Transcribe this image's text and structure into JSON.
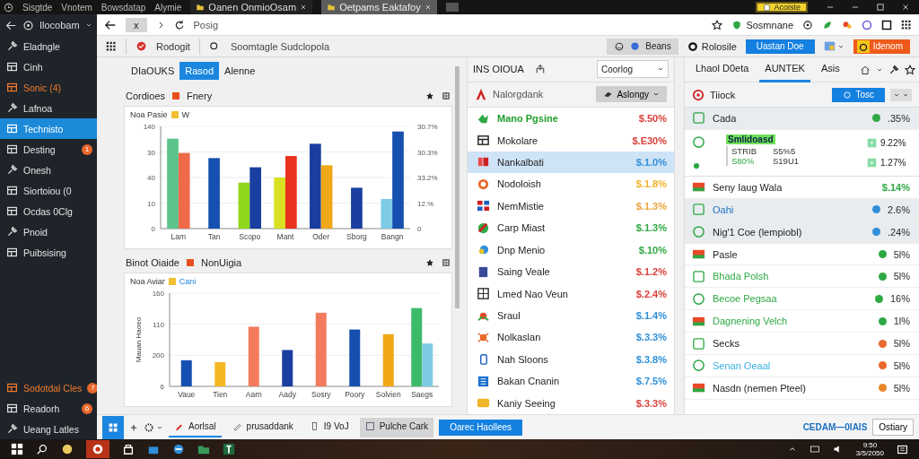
{
  "top_bar": {
    "menu": [
      "Sisgtde",
      "Vnotem",
      "Bowsdatap",
      "Alymie"
    ],
    "tabs": [
      {
        "label": "Oanen OnmioOsam",
        "selected": false
      },
      {
        "label": "Oetpams Eaktafoy",
        "selected": true
      }
    ],
    "badge": "Acoiste"
  },
  "sidebar": {
    "header": "Ilocobam",
    "items": [
      {
        "label": "Eladngle",
        "selected": false,
        "accent": false
      },
      {
        "label": "Cinh",
        "selected": false,
        "accent": false
      },
      {
        "label": "Sonic (4)",
        "selected": false,
        "accent": true
      },
      {
        "label": "Lafnoa",
        "selected": false,
        "accent": false
      },
      {
        "label": "Technisto",
        "selected": true,
        "accent": false
      },
      {
        "label": "Desting",
        "selected": false,
        "accent": false,
        "badge": "1"
      },
      {
        "label": "Onesh",
        "selected": false,
        "accent": false
      },
      {
        "label": "Siortoiou (0",
        "selected": false,
        "accent": false
      },
      {
        "label": "Ocdas 0Clg",
        "selected": false,
        "accent": false
      },
      {
        "label": "Pnoid",
        "selected": false,
        "accent": false
      },
      {
        "label": "Puibsising",
        "selected": false,
        "accent": false
      }
    ],
    "footer_items": [
      {
        "label": "Sodotdal Cles",
        "accent": true,
        "badge": "7"
      },
      {
        "label": "Readorh",
        "accent": false,
        "badge": "6"
      },
      {
        "label": "Ueang Latles",
        "accent": false
      }
    ]
  },
  "address_bar": {
    "stop": "x",
    "url": "Posig",
    "profile": "Sosmnane"
  },
  "toolbar": {
    "app_name": "Rodogit",
    "search_placeholder": "Soomtagle Sudclopola",
    "segment": "Beans",
    "account": "Rolosile",
    "primary_button": "Uastan Doe",
    "action_button": "Idenom"
  },
  "left_pane": {
    "tabs": [
      {
        "label": "DIaOUKS",
        "selected": false
      },
      {
        "label": "Rasod",
        "selected": true
      },
      {
        "label": "Alenne",
        "selected": false
      }
    ],
    "panels": [
      {
        "title": "Cordioes",
        "legend": "Fnery",
        "note": "Noa Pasie",
        "note_legend": "W",
        "right_ticks": [
          "30.7%",
          "30.3%",
          "33.2%",
          "12.%",
          "0"
        ],
        "categories": [
          "Lam",
          "Tan",
          "Scopo",
          "Mant",
          "Oder",
          "Sborg",
          "Bangn"
        ],
        "left_ticks": [
          "140",
          "30",
          "40",
          "10",
          "0"
        ]
      },
      {
        "title": "Binot Oiaide",
        "legend": "NonUigia",
        "note": "Noa Aviar",
        "note_legend": "Cani",
        "ylabel": "Mauan Haoeo",
        "categories": [
          "Vaue",
          "Tien",
          "Aarn",
          "Aady",
          "Sosry",
          "Poory",
          "Solvien",
          "Saegs"
        ],
        "left_ticks": [
          "160",
          "110",
          "200",
          "6"
        ]
      }
    ]
  },
  "middle_pane": {
    "title": "INS OIOUA",
    "dropdown": "Coorlog",
    "source": "Nalorgdank",
    "filter": "Aslongy",
    "rows": [
      {
        "name": "Mano Pgsine",
        "value": "$.50%",
        "color": "#d9413a",
        "selected": false,
        "featured": true
      },
      {
        "name": "Mokolare",
        "value": "$.E30%",
        "color": "#d9413a",
        "selected": false,
        "featured": false
      },
      {
        "name": "Nankalbati",
        "value": "$.1.0%",
        "color": "#2f8fd8",
        "selected": true,
        "featured": false
      },
      {
        "name": "Nodoloish",
        "value": "$.1.8%",
        "color": "#f0b429",
        "selected": false,
        "featured": false
      },
      {
        "name": "NemMistie",
        "value": "$.1.3%",
        "color": "#e8a43a",
        "selected": false,
        "featured": false
      },
      {
        "name": "Carp Miast",
        "value": "$.1.3%",
        "color": "#2ea844",
        "selected": false,
        "featured": false
      },
      {
        "name": "Dnp Menio",
        "value": "$.10%",
        "color": "#2ea844",
        "selected": false,
        "featured": false
      },
      {
        "name": "Saing Veale",
        "value": "$.1.2%",
        "color": "#d9413a",
        "selected": false,
        "featured": false
      },
      {
        "name": "Lmed Nao Veun",
        "value": "$.2.4%",
        "color": "#d9413a",
        "selected": false,
        "featured": false
      },
      {
        "name": "Sraul",
        "value": "$.1.4%",
        "color": "#2f8fd8",
        "selected": false,
        "featured": false
      },
      {
        "name": "Nolkaslan",
        "value": "$.3.3%",
        "color": "#2f8fd8",
        "selected": false,
        "featured": false
      },
      {
        "name": "Nah Sloons",
        "value": "$.3.8%",
        "color": "#2f8fd8",
        "selected": false,
        "featured": false
      },
      {
        "name": "Bakan Cnanin",
        "value": "$.7.5%",
        "color": "#2f8fd8",
        "selected": false,
        "featured": false
      },
      {
        "name": "Kaniy Seeing",
        "value": "$.3.3%",
        "color": "#d9413a",
        "selected": false,
        "featured": false
      }
    ]
  },
  "right_pane": {
    "tabs": [
      {
        "label": "Lhaol D0eta",
        "selected": false
      },
      {
        "label": "AUNTEK",
        "selected": true
      },
      {
        "label": "Asis",
        "selected": false
      }
    ],
    "section": "Tiiock",
    "button": "Tosc",
    "rows": [
      {
        "kind": "item",
        "name": "Cada",
        "value": ".35%",
        "color": "#2ea844",
        "dot": true,
        "shaded": true,
        "link": false,
        "accent": false
      },
      {
        "kind": "detail",
        "title": "Smlidoasd",
        "cells": [
          "STRIB",
          "S5%5",
          "S80%",
          "S19U1"
        ],
        "values": [
          "9.22%",
          "1.27%"
        ]
      },
      {
        "kind": "item",
        "name": "Seny Iaug Wala",
        "value": "$.14%",
        "color": "#2ea844",
        "dot": false,
        "shaded": false,
        "link": false,
        "accent": false
      },
      {
        "kind": "item",
        "name": "Oahi",
        "value": "2.6%",
        "color": "#2f8fd8",
        "dot": true,
        "shaded": true,
        "link": true,
        "accent": false
      },
      {
        "kind": "item",
        "name": "Nig'1 Coe (lempiobl)",
        "value": ".24%",
        "color": "#2f8fd8",
        "dot": true,
        "shaded": true,
        "link": false,
        "accent": false
      },
      {
        "kind": "item",
        "name": "Pasle",
        "value": "5l%",
        "color": "#2ea844",
        "dot": true,
        "shaded": false,
        "link": false,
        "accent": false
      },
      {
        "kind": "item",
        "name": "Bhada Polsh",
        "value": "5l%",
        "color": "#2ea844",
        "dot": true,
        "shaded": false,
        "link": false,
        "accent": true
      },
      {
        "kind": "item",
        "name": "Becoe Pegsaa",
        "value": "16%",
        "color": "#2ea844",
        "dot": true,
        "shaded": false,
        "link": false,
        "accent": true
      },
      {
        "kind": "item",
        "name": "Dagnening Velch",
        "value": "1l%",
        "color": "#2ea844",
        "dot": true,
        "shaded": false,
        "link": false,
        "accent": true
      },
      {
        "kind": "item",
        "name": "Secks",
        "value": "5l%",
        "color": "#e8672a",
        "dot": true,
        "shaded": false,
        "link": false,
        "accent": false
      },
      {
        "kind": "item",
        "name": "Senan Oeaal",
        "value": "5l%",
        "color": "#e8672a",
        "dot": true,
        "shaded": false,
        "link": true,
        "accent": false
      },
      {
        "kind": "item",
        "name": "Nasdn (nemen Pteel)",
        "value": "5l%",
        "color": "#e8872a",
        "dot": true,
        "shaded": false,
        "link": false,
        "accent": false
      }
    ]
  },
  "bottom_bar": {
    "tabs": [
      {
        "label": "Aorlsal",
        "selected": true,
        "kind": "tab"
      },
      {
        "label": "prusaddank",
        "selected": false,
        "kind": "tab"
      },
      {
        "label": "I9 VoJ",
        "selected": false,
        "kind": "tab"
      },
      {
        "label": "Pulche Cark",
        "selected": false,
        "kind": "chip"
      }
    ],
    "button": "Oarec Haollees",
    "status": "CEDAM—0IAIS",
    "end_button": "Ostiary"
  },
  "taskbar": {
    "time": "9:50",
    "date": "3/5/2050"
  }
}
